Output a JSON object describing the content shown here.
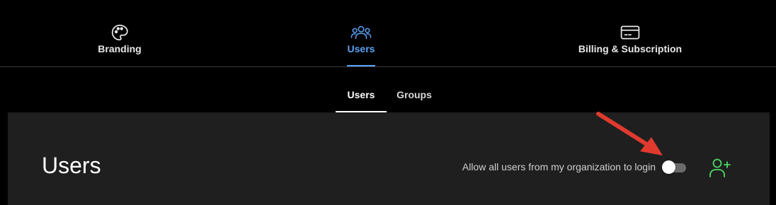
{
  "top_tabs": [
    {
      "label": "Branding",
      "icon": "palette-icon",
      "active": false
    },
    {
      "label": "Users",
      "icon": "users-group-icon",
      "active": true
    },
    {
      "label": "Billing & Subscription",
      "icon": "credit-card-icon",
      "active": false
    }
  ],
  "sub_tabs": [
    {
      "label": "Users",
      "active": true
    },
    {
      "label": "Groups",
      "active": false
    }
  ],
  "panel": {
    "title": "Users",
    "toggle_label": "Allow all users from my organization to login",
    "toggle_on": false,
    "add_user_icon": "add-user-icon"
  },
  "colors": {
    "background": "#000000",
    "panel": "#1f1f1f",
    "accent_blue": "#5aa2f5",
    "add_user_green": "#4cd964",
    "annotation_arrow": "#e03a2f"
  }
}
